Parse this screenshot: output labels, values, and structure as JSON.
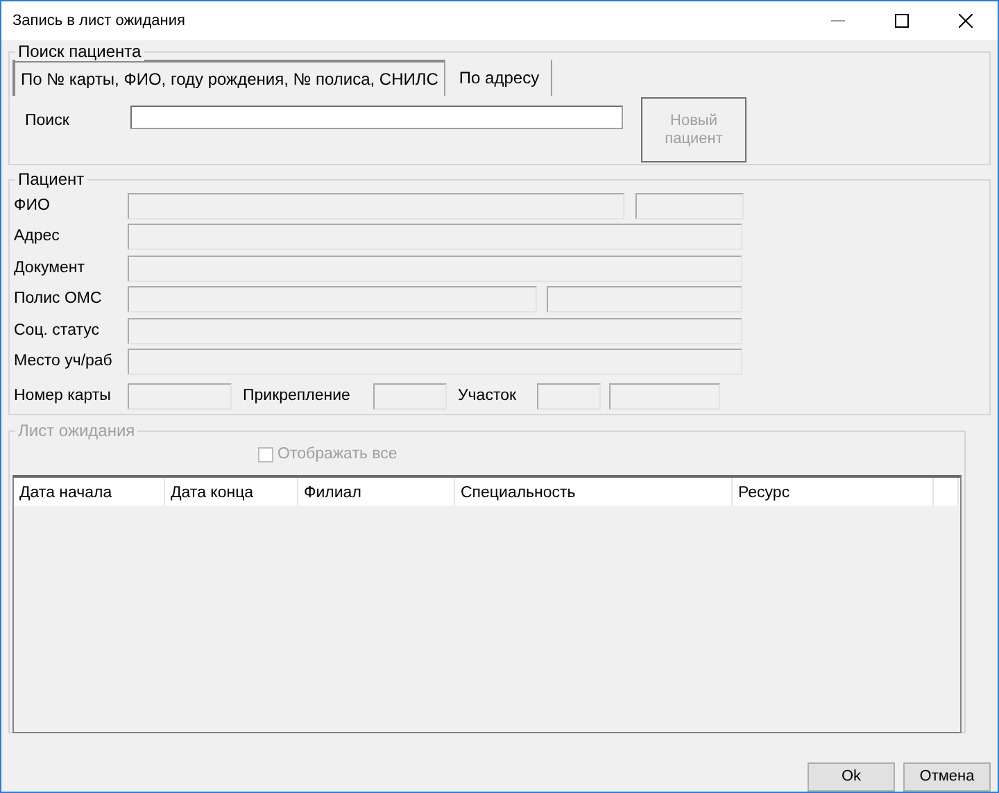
{
  "window": {
    "title": "Запись в лист ожидания"
  },
  "search_group": {
    "title": "Поиск пациента",
    "tabs": [
      {
        "label": "По № карты, ФИО, году рождения, № полиса, СНИЛС",
        "selected": true
      },
      {
        "label": "По адресу",
        "selected": false
      }
    ],
    "search_label": "Поиск",
    "new_patient_button": {
      "label": "Новый пациент",
      "disabled": true
    }
  },
  "patient_group": {
    "title": "Пациент",
    "rows": [
      {
        "label": "ФИО",
        "kind": "split"
      },
      {
        "label": "Адрес",
        "kind": "full"
      },
      {
        "label": "Документ",
        "kind": "full"
      },
      {
        "label": "Полис ОМС",
        "kind": "half"
      },
      {
        "label": "Соц. статус",
        "kind": "full"
      },
      {
        "label": "Место уч/раб",
        "kind": "full"
      }
    ],
    "card_row": [
      {
        "label": "Номер карты",
        "kind": "single"
      },
      {
        "label": "Прикрепление",
        "kind": "single"
      },
      {
        "label": "Участок",
        "kind": "double"
      }
    ]
  },
  "waitlist_group": {
    "title": "Лист ожидания",
    "disabled": true,
    "show_all": {
      "label": "Отображать все",
      "checked": false,
      "disabled": true
    },
    "columns": [
      "Дата начала",
      "Дата конца",
      "Филиал",
      "Специальность",
      "Ресурс"
    ]
  },
  "buttons": [
    "Ok",
    "Отмена"
  ]
}
